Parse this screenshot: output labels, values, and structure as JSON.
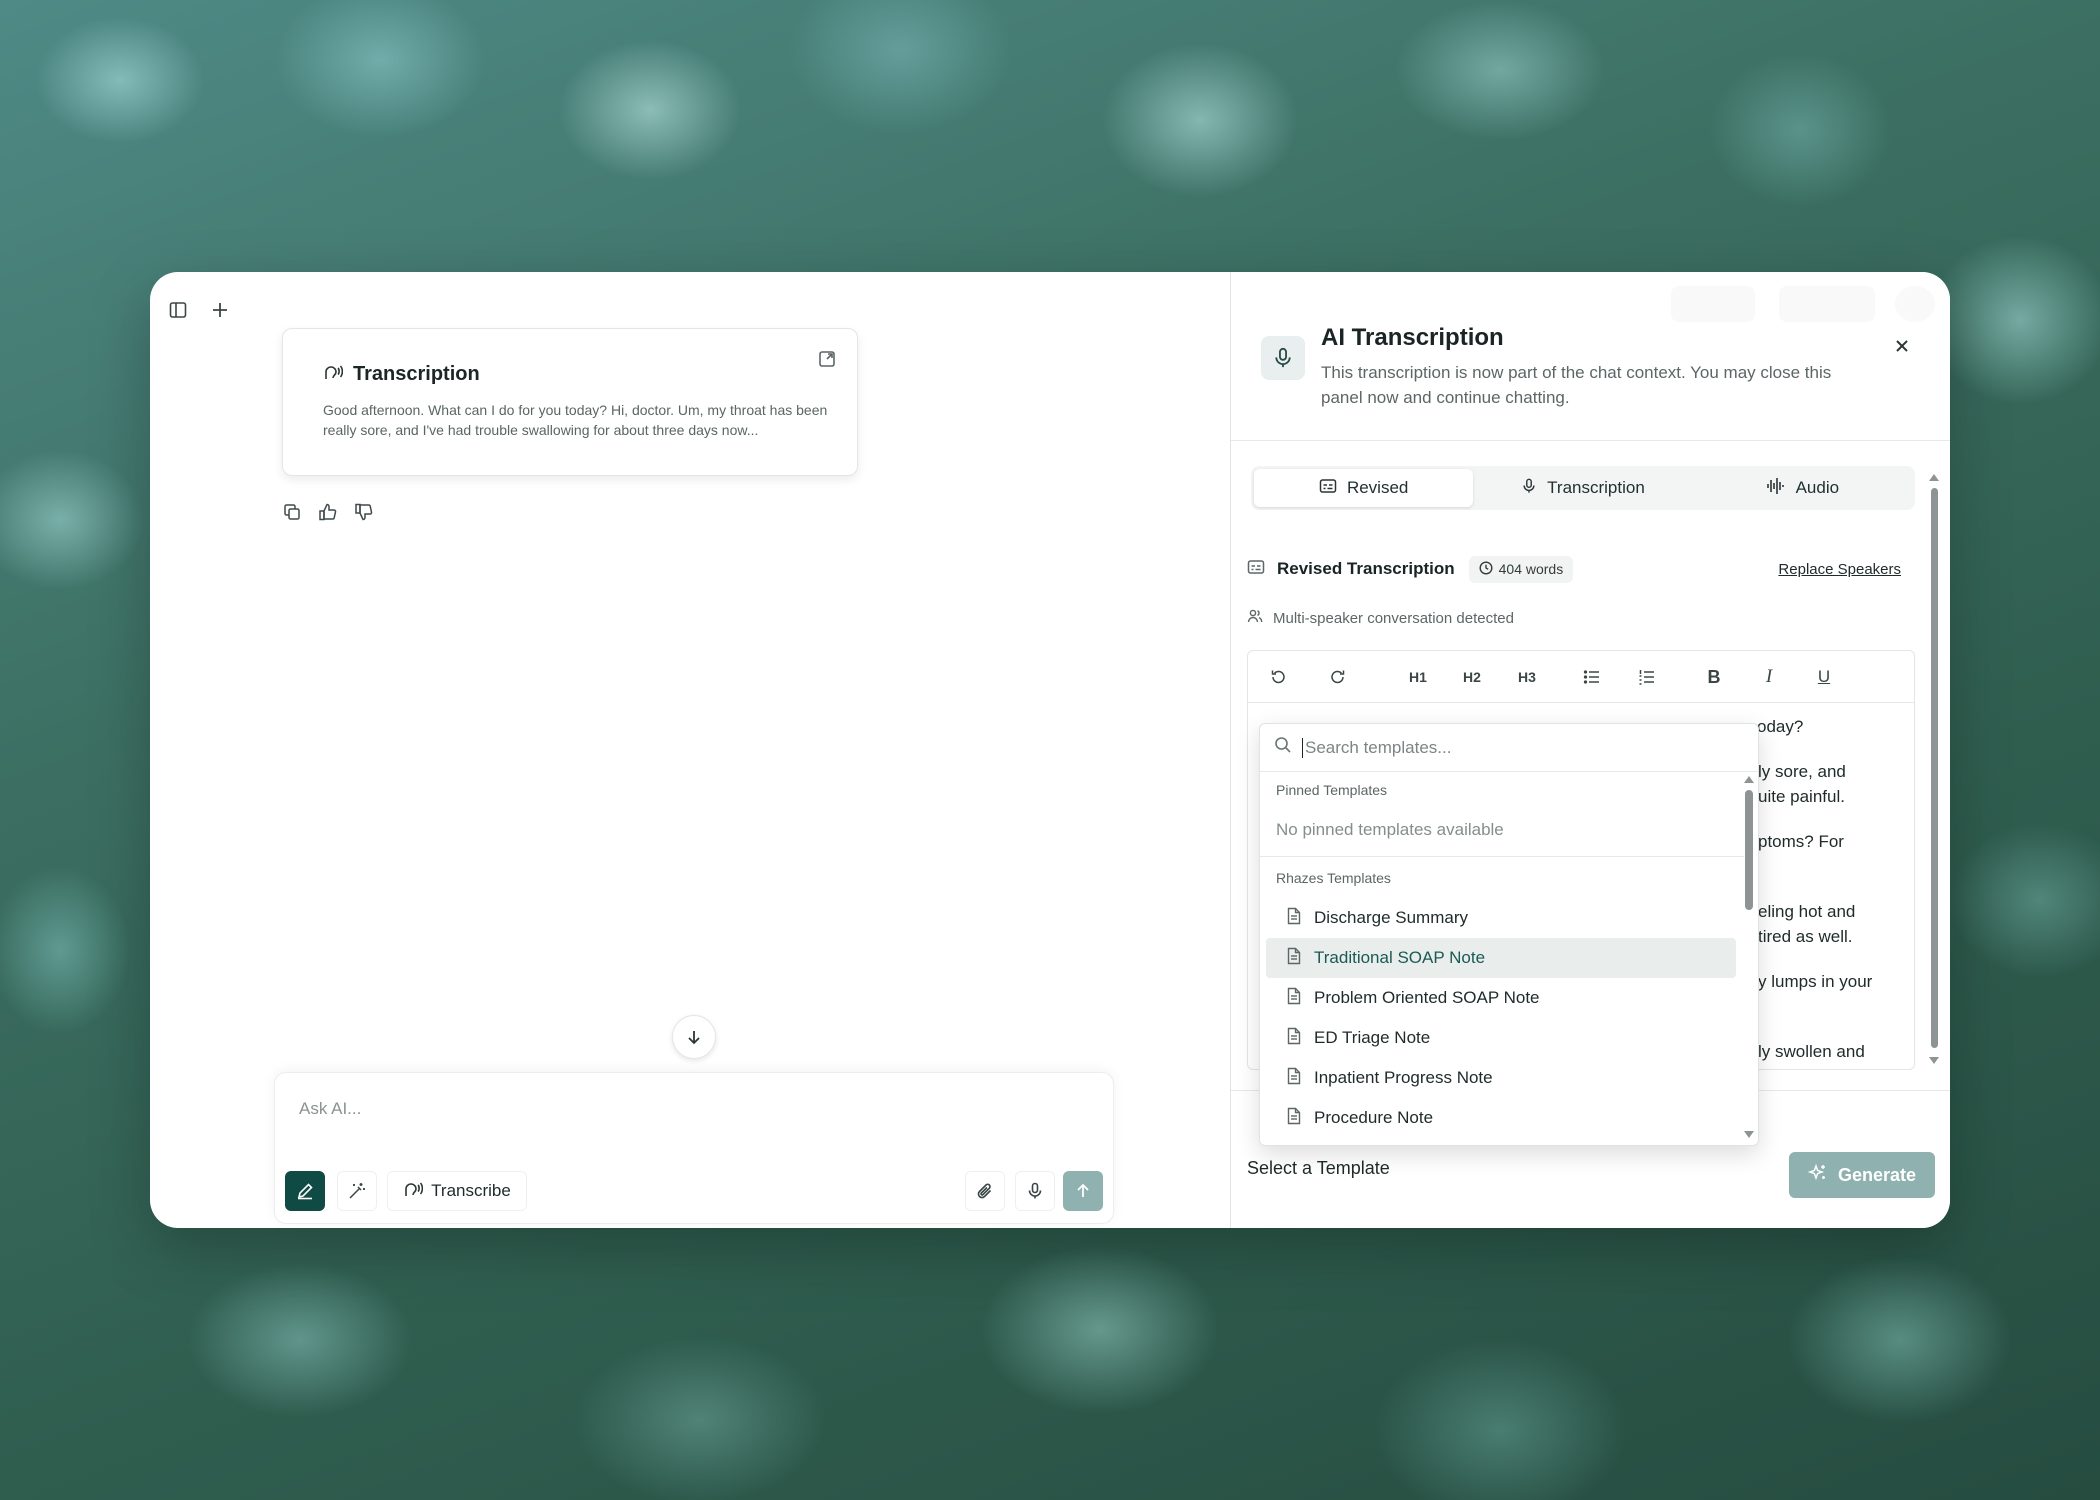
{
  "chat": {
    "card": {
      "title": "Transcription",
      "text": "Good afternoon. What can I do for you today? Hi, doctor. Um, my throat has been really sore, and I've had trouble swallowing for about three days now..."
    },
    "composer": {
      "placeholder": "Ask AI...",
      "transcribe_label": "Transcribe"
    }
  },
  "panel": {
    "title": "AI Transcription",
    "description": "This transcription is now part of the chat context. You may close this panel now and continue chatting.",
    "tabs": [
      {
        "label": "Revised",
        "icon": "caption-icon",
        "active": true
      },
      {
        "label": "Transcription",
        "icon": "mic-icon",
        "active": false
      },
      {
        "label": "Audio",
        "icon": "waveform-icon",
        "active": false
      }
    ],
    "revised_title": "Revised Transcription",
    "word_count": "404 words",
    "replace_speakers": "Replace Speakers",
    "multi_speaker": "Multi-speaker conversation detected",
    "toolbar": {
      "h1": "H1",
      "h2": "H2",
      "h3": "H3",
      "bold": "B",
      "italic": "I",
      "underline": "U"
    },
    "editor_fragments": [
      "oday?",
      "ly sore, and",
      "uite painful.",
      "ptoms? For",
      "eling hot and",
      "tired as well.",
      "y lumps in your",
      "ly swollen and"
    ],
    "select_template": "Select a Template",
    "generate_label": "Generate"
  },
  "dropdown": {
    "search_placeholder": "Search templates...",
    "pinned_label": "Pinned Templates",
    "pinned_empty": "No pinned templates available",
    "section_label": "Rhazes Templates",
    "items": [
      {
        "label": "Discharge Summary",
        "selected": false
      },
      {
        "label": "Traditional SOAP Note",
        "selected": true
      },
      {
        "label": "Problem Oriented SOAP Note",
        "selected": false
      },
      {
        "label": "ED Triage Note",
        "selected": false
      },
      {
        "label": "Inpatient Progress Note",
        "selected": false
      },
      {
        "label": "Procedure Note",
        "selected": false
      }
    ]
  },
  "colors": {
    "accent": "#0f4a45",
    "accent_muted": "#8fb1af",
    "selected_bg": "#e9eeed"
  }
}
